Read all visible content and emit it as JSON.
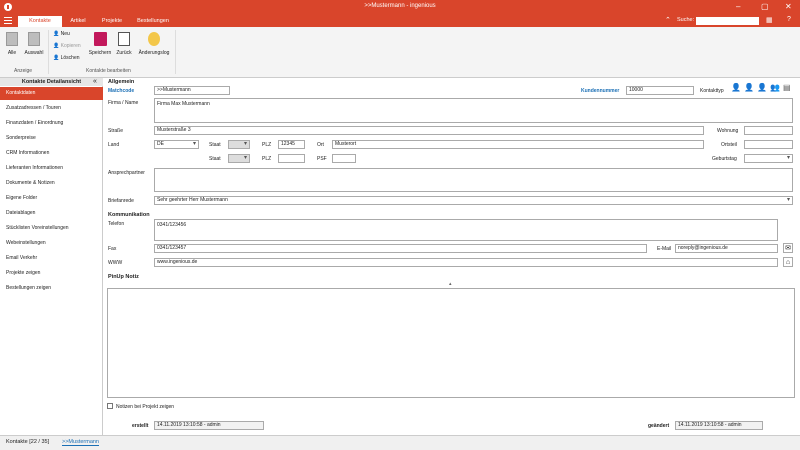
{
  "window": {
    "title": ">>Mustermann - ingenious",
    "min": "–",
    "max": "▢",
    "close": "✕"
  },
  "tabs": [
    {
      "label": "Kontakte"
    },
    {
      "label": "Artikel"
    },
    {
      "label": "Projekte"
    },
    {
      "label": "Bestellungen"
    }
  ],
  "search": {
    "label": "Suche:",
    "value": ""
  },
  "ribbon": {
    "alle": "Alle",
    "auswahl": "Auswahl",
    "neu": "Neu",
    "kopieren": "Kopieren",
    "loeschen": "Löschen",
    "speichern": "Speichern",
    "zurueck": "Zurück",
    "aenderungslog": "Änderungslog",
    "group_anzeige": "Anzeige",
    "group_bearbeiten": "Kontakte bearbeiten"
  },
  "sidebar": {
    "header": "Kontakte Detailansicht",
    "collapse": "«",
    "items": [
      {
        "label": "Kontaktdaten"
      },
      {
        "label": "Zusatzadressen / Touren"
      },
      {
        "label": "Finanzdaten / Einordnung"
      },
      {
        "label": "Sonderpreise"
      },
      {
        "label": "CRM Informationen"
      },
      {
        "label": "Lieferanten Informationen"
      },
      {
        "label": "Dokumente & Notizen"
      },
      {
        "label": "Eigene Folder"
      },
      {
        "label": "Dateiablagen"
      },
      {
        "label": "Stücklisten Voreinstellungen"
      },
      {
        "label": "Webeinstellungen"
      },
      {
        "label": "Email Verkehr"
      },
      {
        "label": "Projekte zeigen"
      },
      {
        "label": "Bestellungen zeigen"
      }
    ]
  },
  "form": {
    "section_allgemein": "Allgemein",
    "matchcode_label": "Matchcode",
    "matchcode": ">>Mustermann",
    "kundennummer_label": "Kundennummer",
    "kundennummer": "10000",
    "kontakttyp_label": "Kontakttyp",
    "firma_label": "Firma / Name",
    "firma": "Firma Max Mustermann",
    "strasse_label": "Straße",
    "strasse": "Musterstraße 3",
    "wohnung_label": "Wohnung",
    "wohnung": "",
    "land_label": "Land",
    "land": "DE",
    "staat_label": "Staat",
    "staat": "",
    "plz_label": "PLZ",
    "plz": "12345",
    "ort_label": "Ort",
    "ort": "Musterort",
    "ortsteil_label": "Ortsteil",
    "ortsteil": "",
    "staat2_label": "Staat",
    "plz2_label": "PLZ",
    "plz2": "",
    "psf_label": "PSF",
    "psf": "",
    "geburtstag_label": "Geburtstag",
    "geburtstag": "",
    "ansprechpartner_label": "Ansprechpartner",
    "ansprechpartner": "",
    "briefanrede_label": "Briefanrede",
    "briefanrede": "Sehr geehrter Herr Mustermann",
    "section_kommunikation": "Kommunikation",
    "telefon_label": "Telefon",
    "telefon": "0341/123456",
    "fax_label": "Fax",
    "fax": "0341/123457",
    "email_label": "E-Mail",
    "email": "noreply@ingenious.de",
    "www_label": "WWW",
    "www": "www.ingenious.de",
    "pinup_label": "PinUp Notiz",
    "pinup": "",
    "notizen_label": "Notizen bei Projekt zeigen",
    "erstellt_label": "erstellt",
    "erstellt": "14.11.2019 13:10:58 - admin",
    "geaendert_label": "geändert",
    "geaendert": "14.11.2019 13:10:58 - admin"
  },
  "statusbar": {
    "tab1": "Kontakte [22 / 35]",
    "tab2": ">>Mustermann"
  }
}
